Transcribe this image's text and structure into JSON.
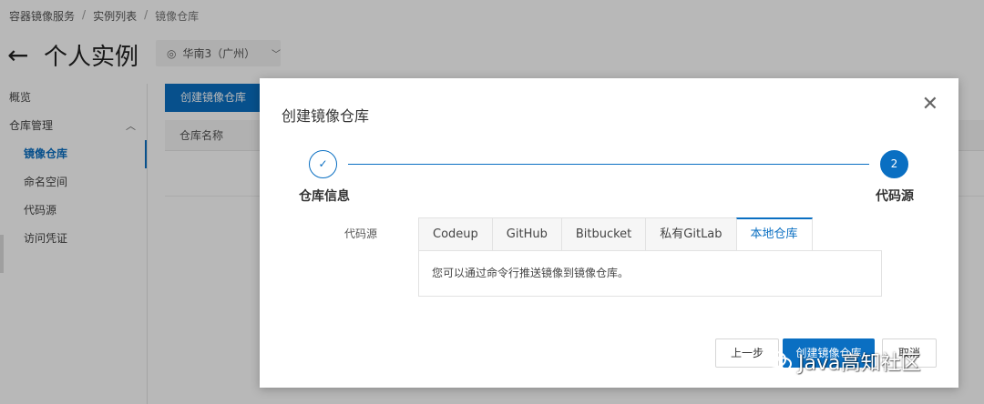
{
  "breadcrumb": {
    "items": [
      "容器镜像服务",
      "实例列表",
      "镜像仓库"
    ],
    "separator": "/"
  },
  "header": {
    "back_icon": "arrow-left-icon",
    "title": "个人实例",
    "region": "华南3（广州）",
    "region_icon": "location-pin-icon",
    "region_chevron": "⌄"
  },
  "sidebar": {
    "items": [
      {
        "label": "概览"
      },
      {
        "label": "仓库管理",
        "caret": "⌃"
      },
      {
        "label": "镜像仓库"
      },
      {
        "label": "命名空间"
      },
      {
        "label": "代码源"
      },
      {
        "label": "访问凭证"
      }
    ]
  },
  "main": {
    "create_button": "创建镜像仓库",
    "table_header": "仓库名称"
  },
  "dialog": {
    "title": "创建镜像仓库",
    "close": "✕",
    "steps": [
      {
        "label": "仓库信息",
        "marker": "✓",
        "state": "done"
      },
      {
        "label": "代码源",
        "marker": "2",
        "state": "current"
      }
    ],
    "source_label": "代码源",
    "tabs": [
      {
        "label": "Codeup"
      },
      {
        "label": "GitHub"
      },
      {
        "label": "Bitbucket"
      },
      {
        "label": "私有GitLab"
      },
      {
        "label": "本地仓库"
      }
    ],
    "active_tab": 4,
    "panel_text": "您可以通过命令行推送镜像到镜像仓库。",
    "buttons": {
      "prev": "上一步",
      "create": "创建镜像仓库",
      "cancel": "取消"
    }
  },
  "watermark": {
    "text": "Java高知社区",
    "icon": "wechat-logo-icon"
  },
  "colors": {
    "primary": "#0a6fc2",
    "overlay": "rgba(0,0,0,0.28)"
  }
}
